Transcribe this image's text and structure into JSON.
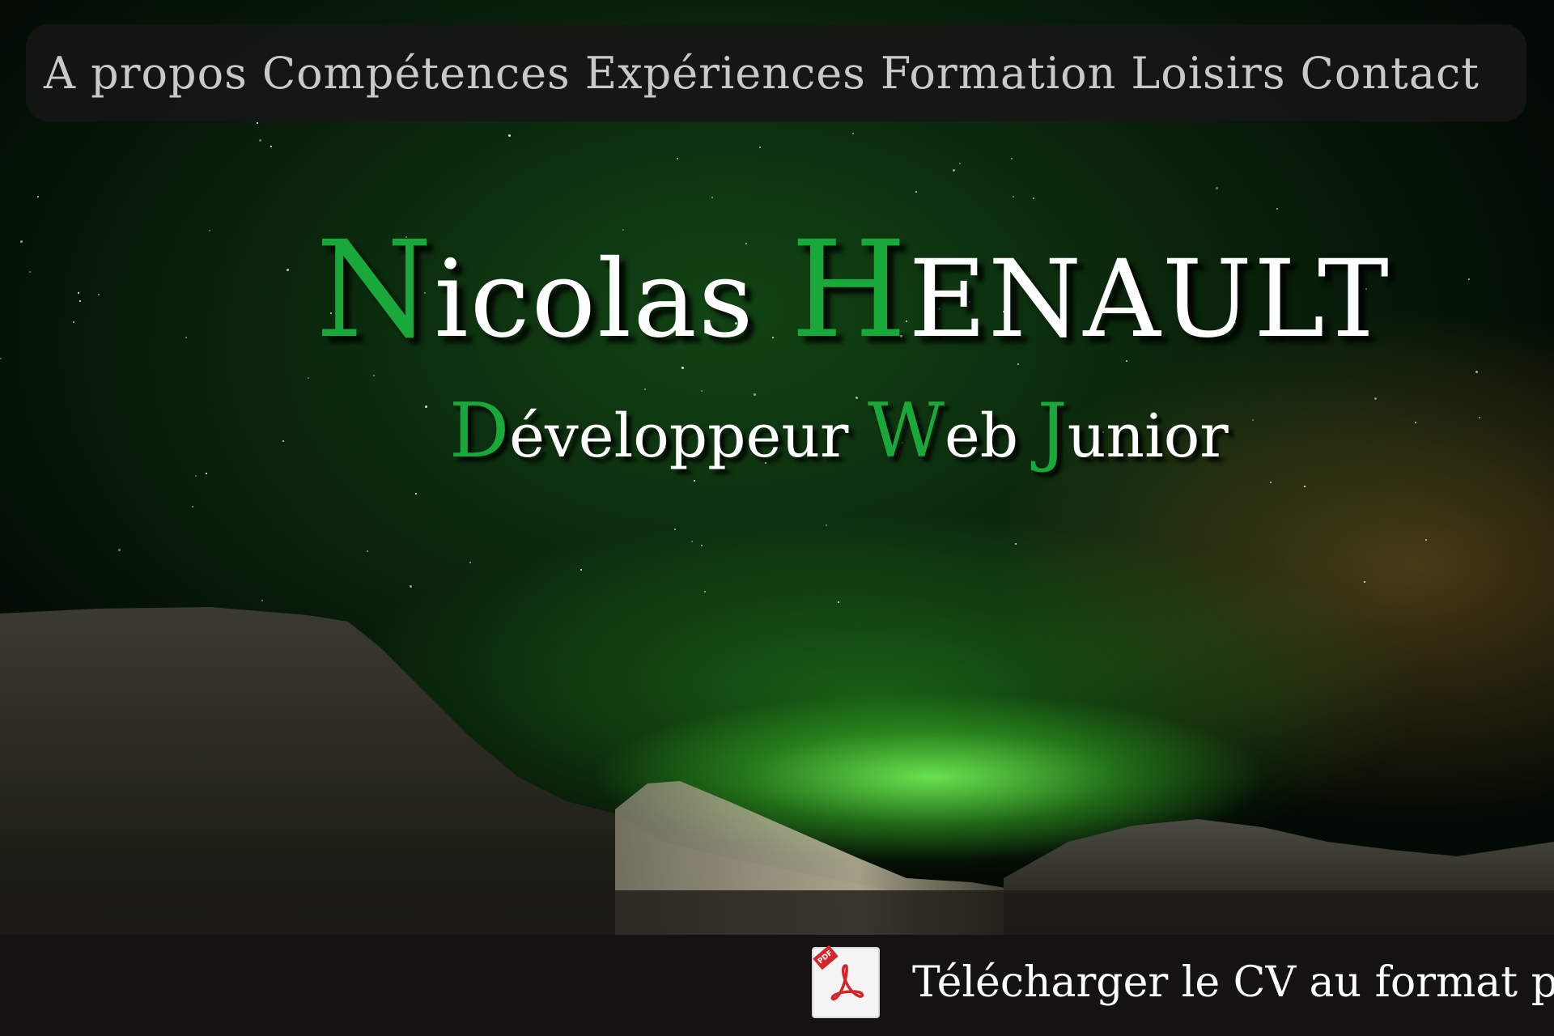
{
  "nav": {
    "items": [
      {
        "label": "A propos"
      },
      {
        "label": "Compétences"
      },
      {
        "label": "Expériences"
      },
      {
        "label": "Formation"
      },
      {
        "label": "Loisirs"
      },
      {
        "label": "Contact"
      }
    ]
  },
  "hero": {
    "first_name": {
      "initial": "N",
      "rest": "icolas"
    },
    "last_name": {
      "initial": "H",
      "rest": "ENAULT"
    },
    "subtitle": {
      "w1_initial": "D",
      "w1_rest": "éveloppeur",
      "w2_initial": "W",
      "w2_rest": "eb",
      "w3_initial": "J",
      "w3_rest": "unior"
    }
  },
  "footer": {
    "cv_label": "Télécharger le CV au format pdf",
    "pdf_badge": "PDF",
    "icon": "pdf-file-icon"
  },
  "colors": {
    "accent": "#19a83a",
    "nav_bg": "#161616",
    "footer_bg": "#141212",
    "text": "#ffffff"
  }
}
